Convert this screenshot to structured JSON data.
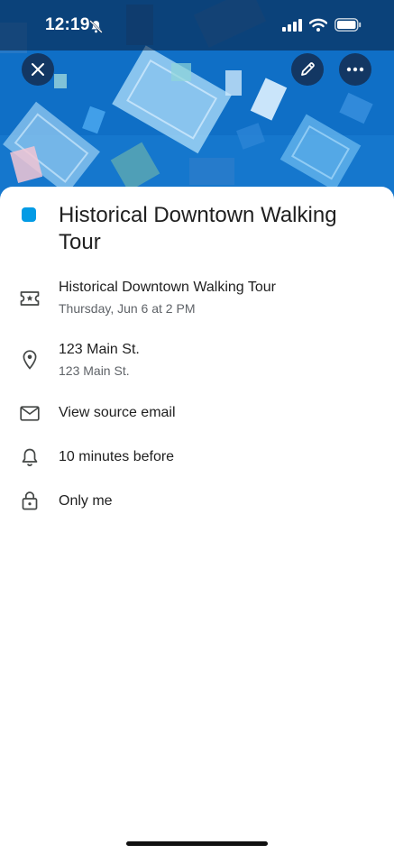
{
  "status_bar": {
    "time": "12:19",
    "bell_icon": "bell-slash-icon",
    "signal_icon": "cellular-signal-icon",
    "wifi_icon": "wifi-icon",
    "battery_icon": "battery-icon"
  },
  "header": {
    "close_icon": "close-icon",
    "edit_icon": "pencil-icon",
    "more_icon": "more-horizontal-icon",
    "banner_color": "#0f6fc6"
  },
  "event": {
    "color": "#039be5",
    "title": "Historical Downtown Walking Tour",
    "details": [
      {
        "icon": "ticket-icon",
        "primary": "Historical Downtown Walking Tour",
        "secondary": "Thursday, Jun 6 at 2 PM"
      },
      {
        "icon": "location-pin-icon",
        "primary": "123 Main St.",
        "secondary": "123 Main St."
      },
      {
        "icon": "mail-icon",
        "primary": "View source email"
      },
      {
        "icon": "bell-icon",
        "primary": "10 minutes before"
      },
      {
        "icon": "lock-icon",
        "primary": "Only me"
      }
    ]
  }
}
